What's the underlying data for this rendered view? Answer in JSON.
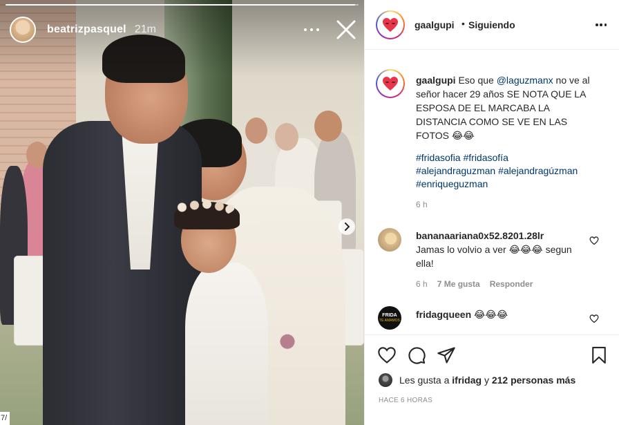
{
  "story": {
    "username": "beatrizpasquel",
    "time": "21m",
    "progress": 0.99,
    "corner_badge": "7/"
  },
  "post": {
    "header": {
      "username": "gaalgupi",
      "separator": "•",
      "follow_status": "Siguiendo"
    },
    "caption": {
      "username": "gaalgupi",
      "text_before_mention": "Eso que ",
      "mention": "@laguzmanx",
      "text_after_mention": " no ve al señor hacer 29 años SE NOTA QUE LA ESPOSA DE EL MARCABA LA DISTANCIA COMO SE VE EN LAS FOTOS 😂😂",
      "hashtags": [
        "#fridasofia",
        "#fridasofía",
        "#alejandraguzman",
        "#alejandragúzman",
        "#enriqueguzman"
      ],
      "time": "6 h"
    },
    "comments": [
      {
        "username": "bananaariana0x52.8201.28lr",
        "text": "Jamas lo volvio a ver 😂😂😂 segun ella!",
        "time": "6 h",
        "likes": "7 Me gusta",
        "reply": "Responder"
      },
      {
        "username": "fridagqueen",
        "text": "😂😂😂",
        "avatar_text": "FRIDA",
        "avatar_subtext": "TE AMAMOS"
      }
    ],
    "likes": {
      "prefix": "Les gusta a ",
      "user": "ifridag",
      "middle": " y ",
      "count": "212 personas más"
    },
    "date": "HACE 6 HORAS"
  },
  "colors": {
    "text": "#262626",
    "muted": "#8e8e8e",
    "link": "#00376b",
    "heart": "#e8354a",
    "border": "#efefef"
  },
  "icons": [
    "more-icon",
    "close-icon",
    "chevron-right-icon",
    "heart-logo-icon",
    "like-icon",
    "comment-icon",
    "share-icon",
    "save-icon"
  ]
}
